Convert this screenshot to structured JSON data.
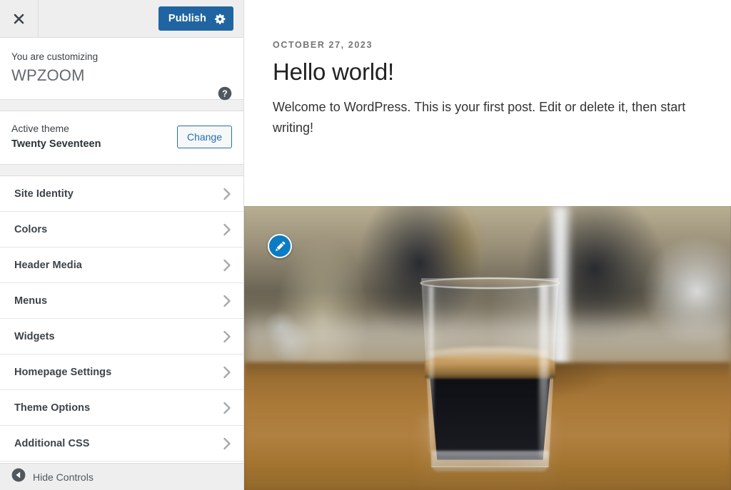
{
  "customizer": {
    "header": {
      "close_icon": "close-x-icon",
      "publish_label": "Publish",
      "publish_gear_icon": "gear-icon",
      "publish_color": "#2065a1"
    },
    "info": {
      "customizing_label": "You are customizing",
      "site_title": "WPZOOM",
      "help_icon": "help-circle-icon"
    },
    "theme": {
      "kicker": "Active theme",
      "name": "Twenty Seventeen",
      "change_label": "Change",
      "change_accent": "#2271b1"
    },
    "sections": [
      {
        "label": "Site Identity",
        "chevron": "chevron-right-icon"
      },
      {
        "label": "Colors",
        "chevron": "chevron-right-icon"
      },
      {
        "label": "Header Media",
        "chevron": "chevron-right-icon"
      },
      {
        "label": "Menus",
        "chevron": "chevron-right-icon"
      },
      {
        "label": "Widgets",
        "chevron": "chevron-right-icon"
      },
      {
        "label": "Homepage Settings",
        "chevron": "chevron-right-icon"
      },
      {
        "label": "Theme Options",
        "chevron": "chevron-right-icon"
      },
      {
        "label": "Additional CSS",
        "chevron": "chevron-right-icon"
      }
    ],
    "footer": {
      "collapse_icon": "collapse-left-arrow-icon",
      "hide_controls_label": "Hide Controls"
    }
  },
  "preview": {
    "post": {
      "date": "OCTOBER 27, 2023",
      "title": "Hello world!",
      "excerpt": "Welcome to WordPress. This is your first post. Edit or delete it, then start writing!"
    },
    "header_image": {
      "alt": "Blurred cafe photo of a glass of espresso on a wooden table",
      "edit_shortcut_icon": "pencil-edit-icon",
      "edit_shortcut_color": "#0b7cc1"
    }
  }
}
